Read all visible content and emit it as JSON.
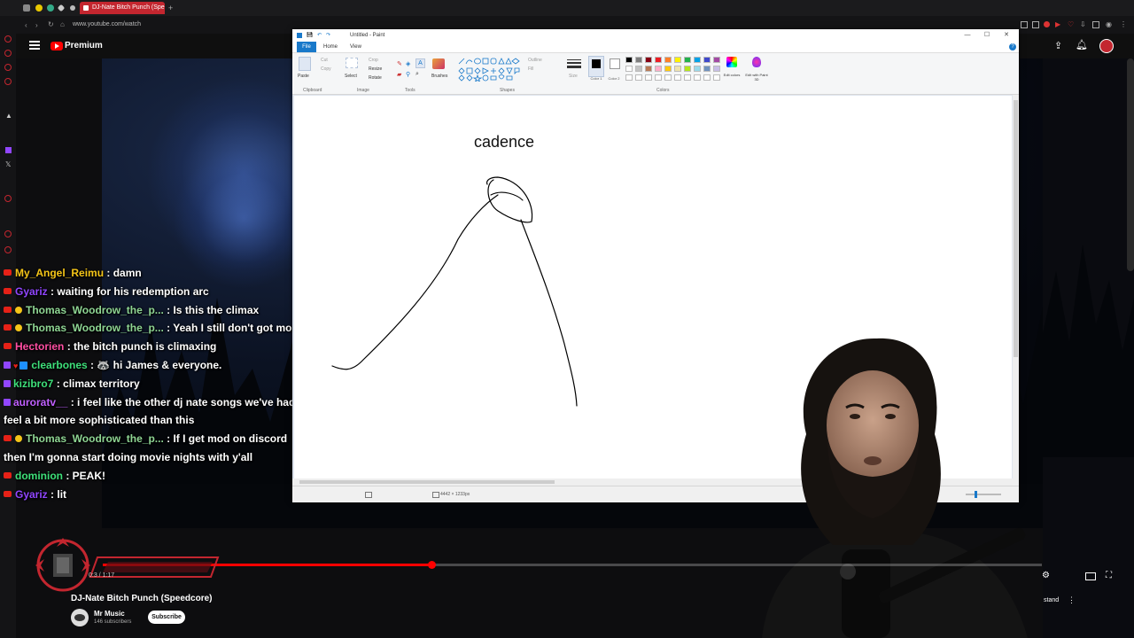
{
  "browser": {
    "active_tab_title": "DJ-Nate Bitch Punch (Spe",
    "new_tab": "+",
    "url": "www.youtube.com/watch"
  },
  "youtube": {
    "logo_label": "Premium",
    "video_title": "DJ-Nate Bitch Punch (Speedcore)",
    "channel_name": "Mr Music",
    "subscriber_count": "146 subscribers",
    "subscribe_label": "Subscribe",
    "timecode": "0:3 / 1:17",
    "progress_fraction": 0.35
  },
  "chat": [
    {
      "platform": "youtube",
      "badges": [],
      "user": "My_Angel_Reimu",
      "color": "#f5c518",
      "text": ": damn"
    },
    {
      "platform": "youtube",
      "badges": [],
      "user": "Gyariz",
      "color": "#9146ff",
      "text": ": waiting for his redemption arc"
    },
    {
      "platform": "youtube",
      "badges": [
        "member"
      ],
      "user": "Thomas_Woodrow_the_p...",
      "color": "#8fd694",
      "text": ": Is this the climax"
    },
    {
      "platform": "youtube",
      "badges": [
        "member"
      ],
      "user": "Thomas_Woodrow_the_p...",
      "color": "#8fd694",
      "text": ": Yeah I still don't got mod"
    },
    {
      "platform": "youtube",
      "badges": [],
      "user": "Hectorien",
      "color": "#ff4fa3",
      "text": ": the bitch punch is climaxing"
    },
    {
      "platform": "twitch",
      "badges": [
        "heart",
        "blue"
      ],
      "user": "clearbones",
      "color": "#3ee07a",
      "text": ": 🦝 hi James & everyone."
    },
    {
      "platform": "twitch",
      "badges": [],
      "user": "kizibro7",
      "color": "#3ee07a",
      "text": ": climax territory"
    },
    {
      "platform": "twitch",
      "badges": [],
      "user": "auroratv__",
      "color": "#c060ff",
      "text": ": i feel like the other dj nate songs we've had"
    },
    {
      "platform": "none",
      "badges": [],
      "user": "",
      "color": "#ffffff",
      "text": "feel a bit more sophisticated than this"
    },
    {
      "platform": "youtube",
      "badges": [
        "member"
      ],
      "user": "Thomas_Woodrow_the_p...",
      "color": "#8fd694",
      "text": ": If I get mod on discord"
    },
    {
      "platform": "none",
      "badges": [],
      "user": "",
      "color": "#ffffff",
      "text": "then I'm gonna start doing movie nights with y'all"
    },
    {
      "platform": "youtube",
      "badges": [],
      "user": "dominion",
      "color": "#3ee07a",
      "text": ": PEAK!"
    },
    {
      "platform": "youtube",
      "badges": [],
      "user": "Gyariz",
      "color": "#9146ff",
      "text": ": lit"
    }
  ],
  "paint": {
    "window_title": "Untitled - Paint",
    "tabs": {
      "file": "File",
      "home": "Home",
      "view": "View"
    },
    "ribbon": {
      "paste": "Paste",
      "cut": "Cut",
      "copy": "Copy",
      "select": "Select",
      "crop": "Crop",
      "resize": "Resize",
      "rotate": "Rotate",
      "brushes": "Brushes",
      "outline": "Outline",
      "fill": "Fill",
      "size": "Size",
      "color1": "Color 1",
      "color2": "Color 2",
      "edit_colors": "Edit colors",
      "edit_paint3d": "Edit with Paint 3D"
    },
    "groups": {
      "clipboard": "Clipboard",
      "image": "Image",
      "tools": "Tools",
      "shapes": "Shapes",
      "colors": "Colors"
    },
    "palette": [
      "#000000",
      "#7f7f7f",
      "#880015",
      "#ed1c24",
      "#ff7f27",
      "#fff200",
      "#22b14c",
      "#00a2e8",
      "#3f48cc",
      "#a349a4",
      "#ffffff",
      "#c3c3c3",
      "#b97a57",
      "#ffaec9",
      "#ffc90e",
      "#efe4b0",
      "#b5e61d",
      "#99d9ea",
      "#7092be",
      "#c8bfe7"
    ],
    "canvas_text": "cadence",
    "canvas_size": "4442 × 1233px"
  },
  "stream_overlay": {
    "right_label": "stand"
  }
}
